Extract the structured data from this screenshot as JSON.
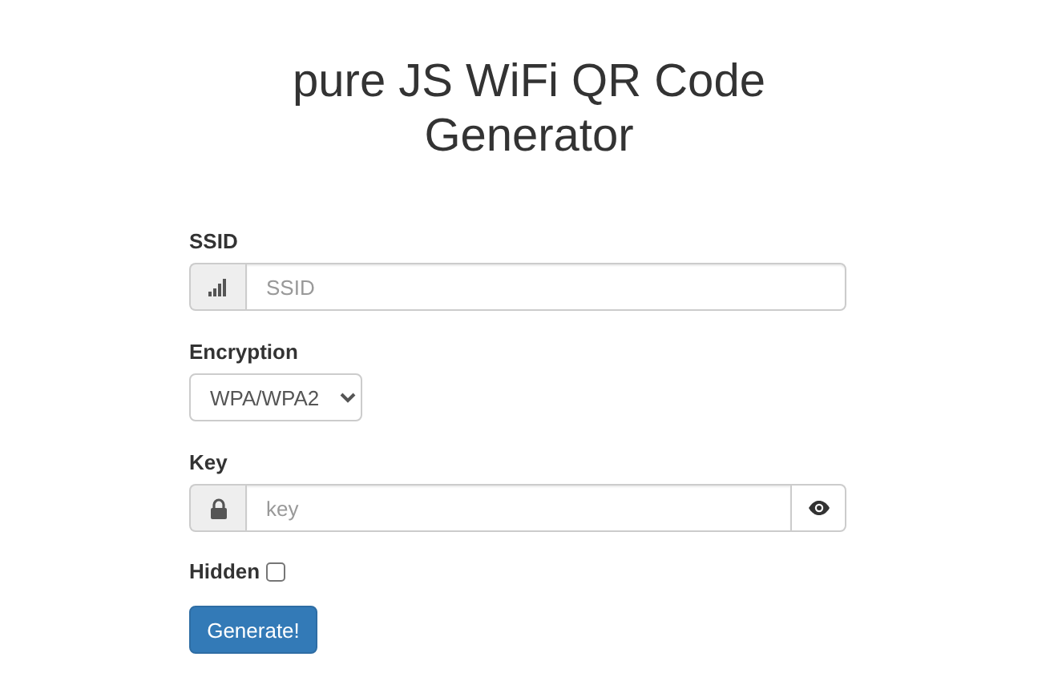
{
  "title": "pure JS WiFi QR Code Generator",
  "fields": [
    {
      "kind": "text",
      "label": "SSID",
      "placeholder": "SSID"
    },
    {
      "kind": "select",
      "label": "Encryption",
      "value": "WPA/WPA2"
    },
    {
      "kind": "password",
      "label": "Key",
      "placeholder": "key"
    },
    {
      "kind": "checkbox",
      "label": "Hidden",
      "checked": false
    }
  ],
  "button": "Generate!"
}
